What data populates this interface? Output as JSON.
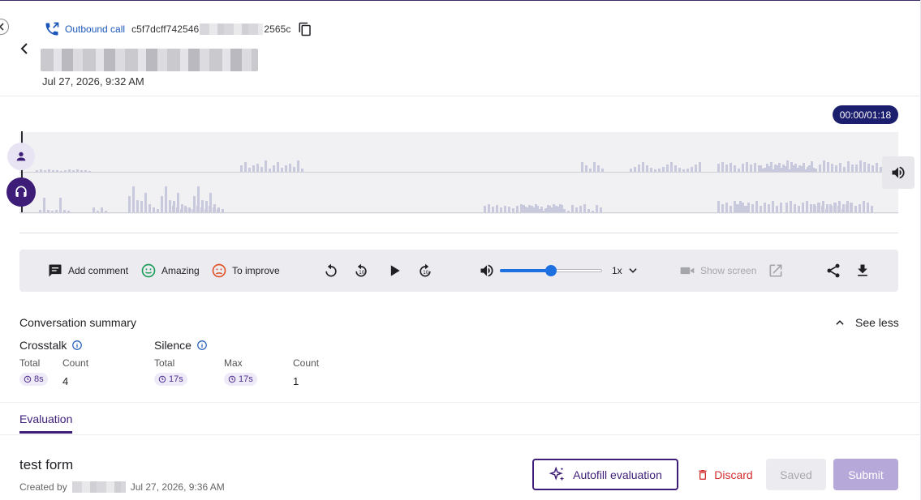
{
  "header": {
    "call_type": "Outbound call",
    "call_id_prefix": "c5f7dcff742546",
    "call_id_suffix": "2565c",
    "call_date": "Jul 27, 2026, 9:32 AM"
  },
  "player": {
    "time": "00:00/01:18",
    "volume_fraction": 0.5,
    "speed": "1x",
    "controls": {
      "add_comment": "Add comment",
      "amazing": "Amazing",
      "to_improve": "To improve",
      "show_screen": "Show screen"
    },
    "colors": {
      "accent": "#3e1d78",
      "slider": "#1e6fe0",
      "time_pill": "#1c1e6e"
    }
  },
  "summary": {
    "title": "Conversation summary",
    "toggle": "See less",
    "crosstalk": {
      "title": "Crosstalk",
      "total_label": "Total",
      "total_value": "8s",
      "count_label": "Count",
      "count_value": "4"
    },
    "silence": {
      "title": "Silence",
      "total_label": "Total",
      "total_value": "17s",
      "max_label": "Max",
      "max_value": "17s",
      "count_label": "Count",
      "count_value": "1"
    }
  },
  "tabs": {
    "evaluation": "Evaluation"
  },
  "form": {
    "title": "test form",
    "created_by": "Created by",
    "created_date": "Jul 27, 2026, 9:36 AM",
    "autofill": "Autofill evaluation",
    "discard": "Discard",
    "saved": "Saved",
    "submit": "Submit",
    "colors": {
      "discard": "#d32f2f",
      "submit": "#b6a8d8"
    }
  }
}
